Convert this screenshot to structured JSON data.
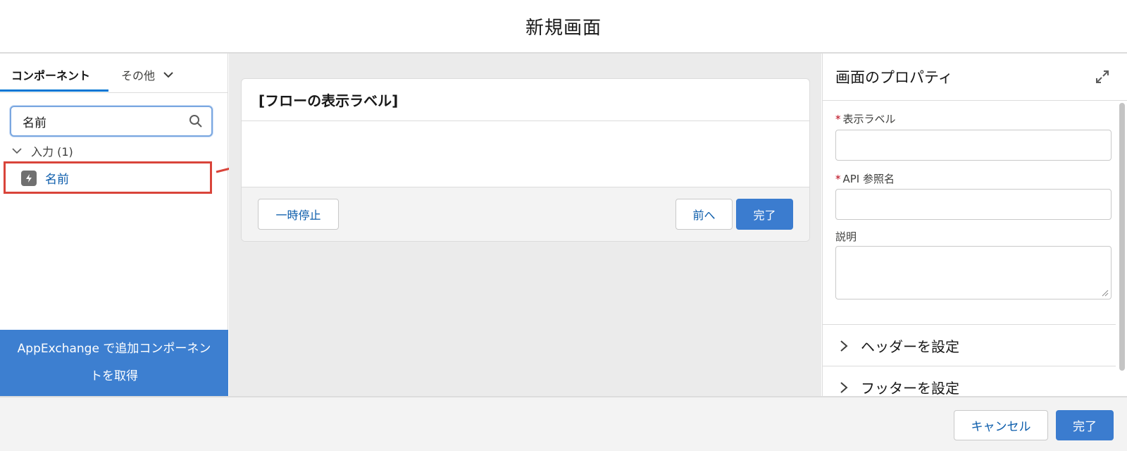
{
  "header": {
    "title": "新規画面"
  },
  "left_panel": {
    "tabs": [
      {
        "label": "コンポーネント",
        "active": true
      },
      {
        "label": "その他",
        "active": false
      }
    ],
    "search": {
      "value": "名前",
      "icon": "search-icon"
    },
    "group": {
      "label": "入力 (1)",
      "icon": "chevron-down-icon"
    },
    "items": [
      {
        "label": "名前",
        "icon": "lightning-icon"
      }
    ],
    "appexchange_label": "AppExchange で追加コンポーネントを取得"
  },
  "canvas": {
    "screen_title": "[フローの表示ラベル]",
    "buttons": {
      "pause": "一時停止",
      "previous": "前へ",
      "finish": "完了"
    }
  },
  "properties": {
    "title": "画面のプロパティ",
    "fields": [
      {
        "label": "表示ラベル",
        "required": true,
        "value": ""
      },
      {
        "label": "API 参照名",
        "required": true,
        "value": ""
      },
      {
        "label": "説明",
        "required": false,
        "value": ""
      }
    ],
    "sections": [
      {
        "label": "ヘッダーを設定"
      },
      {
        "label": "フッターを設定"
      }
    ]
  },
  "footer": {
    "cancel": "キャンセル",
    "done": "完了"
  },
  "colors": {
    "brand": "#3b7ccf",
    "highlight": "#d9443a",
    "link": "#0b5cab"
  }
}
